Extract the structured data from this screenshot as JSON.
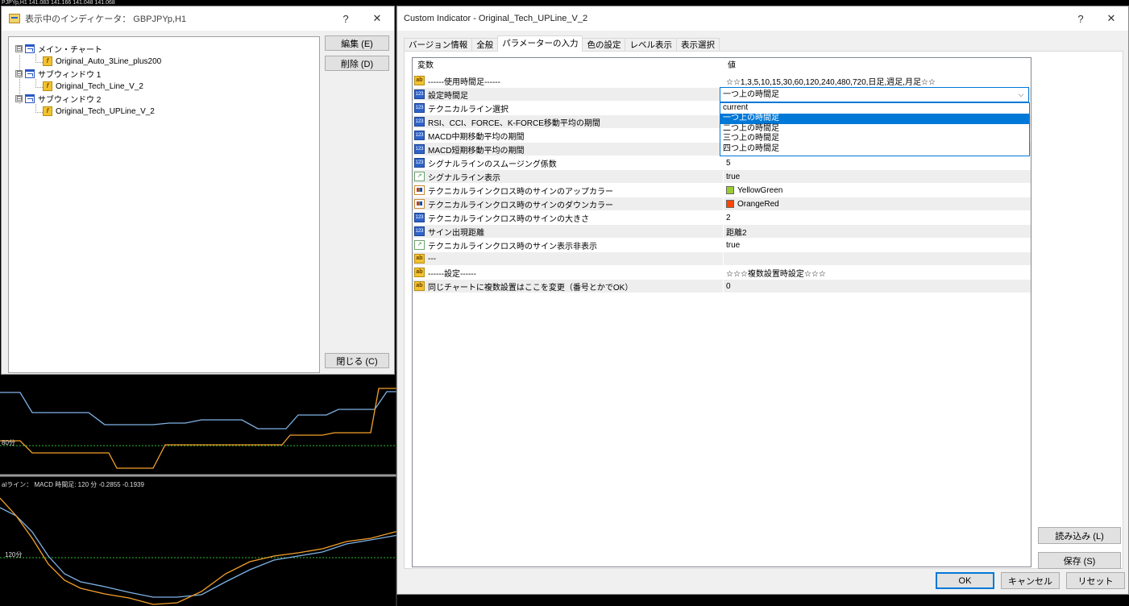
{
  "background": {
    "top_strip": "PJPYp,H1  141.083 141.166 141.048 141.068",
    "label_80": "80分",
    "macd_header": "alライン： MACD  時間足: 120 分 -0.2855 -0.1939",
    "label_120": "120分",
    "colors": {
      "line_blue": "#7fb3e6",
      "line_orange": "#f5a02a",
      "level_green": "#2dbb2d"
    }
  },
  "left_dialog": {
    "title": "表示中のインディケータ： GBPJPYp,H1",
    "help": "?",
    "close": "✕",
    "tree": [
      {
        "label": "メイン・チャート",
        "expander": "⊟"
      },
      {
        "label": "Original_Auto_3Line_plus200"
      },
      {
        "label": "サブウィンドウ 1",
        "expander": "⊟"
      },
      {
        "label": "Original_Tech_Line_V_2"
      },
      {
        "label": "サブウィンドウ 2",
        "expander": "⊟"
      },
      {
        "label": "Original_Tech_UPLine_V_2"
      }
    ],
    "buttons": {
      "edit": "編集 (E)",
      "delete": "削除 (D)",
      "close": "閉じる (C)"
    }
  },
  "right_dialog": {
    "title": "Custom Indicator - Original_Tech_UPLine_V_2",
    "help": "?",
    "close": "✕",
    "tabs": [
      "バージョン情報",
      "全般",
      "パラメーターの入力",
      "色の設定",
      "レベル表示",
      "表示選択"
    ],
    "active_tab": "パラメーターの入力",
    "grid": {
      "col_name": "変数",
      "col_value": "値",
      "rows": [
        {
          "icon": "ab",
          "name": "------使用時間足------",
          "value": "☆☆1,3,5,10,15,30,60,120,240,480,720,日足,週足,月足☆☆"
        },
        {
          "icon": "123",
          "name": "設定時間足",
          "value": ""
        },
        {
          "icon": "123",
          "name": "テクニカルライン選択",
          "value": ""
        },
        {
          "icon": "123",
          "name": "RSI、CCI、FORCE、K-FORCE移動平均の期間",
          "value": ""
        },
        {
          "icon": "123",
          "name": "MACD中期移動平均の期間",
          "value": ""
        },
        {
          "icon": "123",
          "name": "MACD短期移動平均の期間",
          "value": ""
        },
        {
          "icon": "123",
          "name": "シグナルラインのスムージング係数",
          "value": "5"
        },
        {
          "icon": "bool",
          "name": "シグナルライン表示",
          "value": "true"
        },
        {
          "icon": "color",
          "name": "テクニカルラインクロス時のサインのアップカラー",
          "value": "YellowGreen",
          "swatch": "#9acd32"
        },
        {
          "icon": "color",
          "name": "テクニカルラインクロス時のサインのダウンカラー",
          "value": "OrangeRed",
          "swatch": "#ff4500"
        },
        {
          "icon": "123",
          "name": "テクニカルラインクロス時のサインの大きさ",
          "value": "2"
        },
        {
          "icon": "123",
          "name": "サイン出現距離",
          "value": "距離2"
        },
        {
          "icon": "bool",
          "name": "テクニカルラインクロス時のサイン表示非表示",
          "value": "true"
        },
        {
          "icon": "ab",
          "name": "---",
          "value": ""
        },
        {
          "icon": "ab",
          "name": "------設定------",
          "value": "☆☆☆複数設置時設定☆☆☆"
        },
        {
          "icon": "ab",
          "name": "同じチャートに複数設置はここを変更（番号とかでOK）",
          "value": "0"
        }
      ]
    },
    "combo": {
      "value": "一つ上の時間足",
      "arrow": "⌵",
      "options": [
        "current",
        "一つ上の時間足",
        "二つ上の時間足",
        "三つ上の時間足",
        "四つ上の時間足"
      ],
      "selected_index": 1
    },
    "side_buttons": {
      "load": "読み込み (L)",
      "save": "保存 (S)"
    },
    "footer_buttons": {
      "ok": "OK",
      "cancel": "キャンセル",
      "reset": "リセット"
    }
  }
}
